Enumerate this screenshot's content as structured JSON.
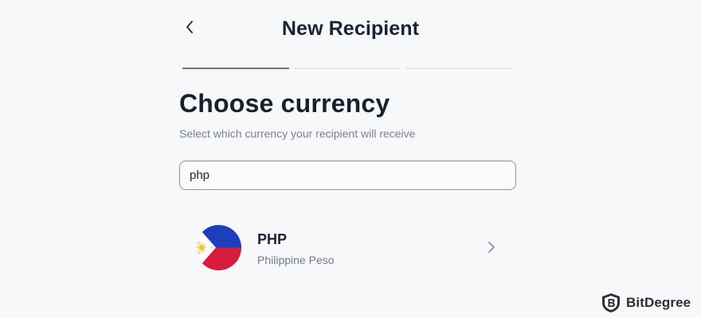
{
  "header": {
    "title": "New Recipient",
    "back_icon": "chevron-left-icon"
  },
  "progress": {
    "current_step": 1,
    "total_steps": 3,
    "active_color": "#717b57",
    "inactive_color": "#e3e5e9"
  },
  "main": {
    "title": "Choose currency",
    "subtitle": "Select which currency your recipient will receive",
    "search": {
      "value": "php",
      "placeholder": ""
    },
    "results": [
      {
        "code": "PHP",
        "name": "Philippine Peso",
        "flag_icon": "philippines-flag-icon",
        "action_icon": "chevron-right-icon"
      }
    ]
  },
  "watermark": {
    "text": "BitDegree",
    "icon": "bitdegree-shield-logo"
  },
  "colors": {
    "background": "#f7f8fa",
    "text_primary": "#17202f",
    "text_secondary": "#7b8190",
    "flag_blue": "#1d3fbd",
    "flag_red": "#d61c38",
    "flag_white": "#ffffff",
    "flag_sun": "#f2c430"
  }
}
